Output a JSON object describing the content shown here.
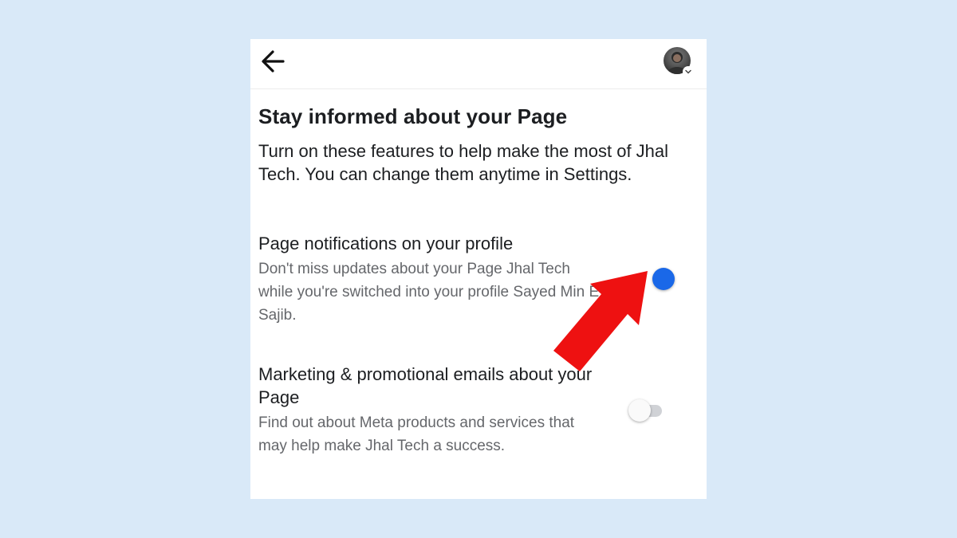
{
  "colors": {
    "background": "#d9e9f8",
    "toggle_on": "#1a68e8",
    "annotation_arrow": "#ee1111"
  },
  "header": {
    "back_icon": "arrow-left-icon",
    "avatar_icon": "profile-avatar",
    "avatar_chevron_icon": "chevron-down-icon"
  },
  "content": {
    "title": "Stay informed about your Page",
    "intro": "Turn on these features to help make the most of Jhal Tech. You can change them anytime in Settings."
  },
  "settings": [
    {
      "title": "Page notifications on your profile",
      "description": "Don't miss updates about your Page Jhal Tech while you're switched into your profile Sayed Min E Sajib.",
      "enabled": true
    },
    {
      "title": "Marketing & promotional emails about your Page",
      "description": "Find out about Meta products and services that may help make Jhal Tech a success.",
      "enabled": false
    }
  ],
  "annotation": {
    "icon": "red-pointer-arrow",
    "target": "Page notifications on your profile toggle"
  }
}
